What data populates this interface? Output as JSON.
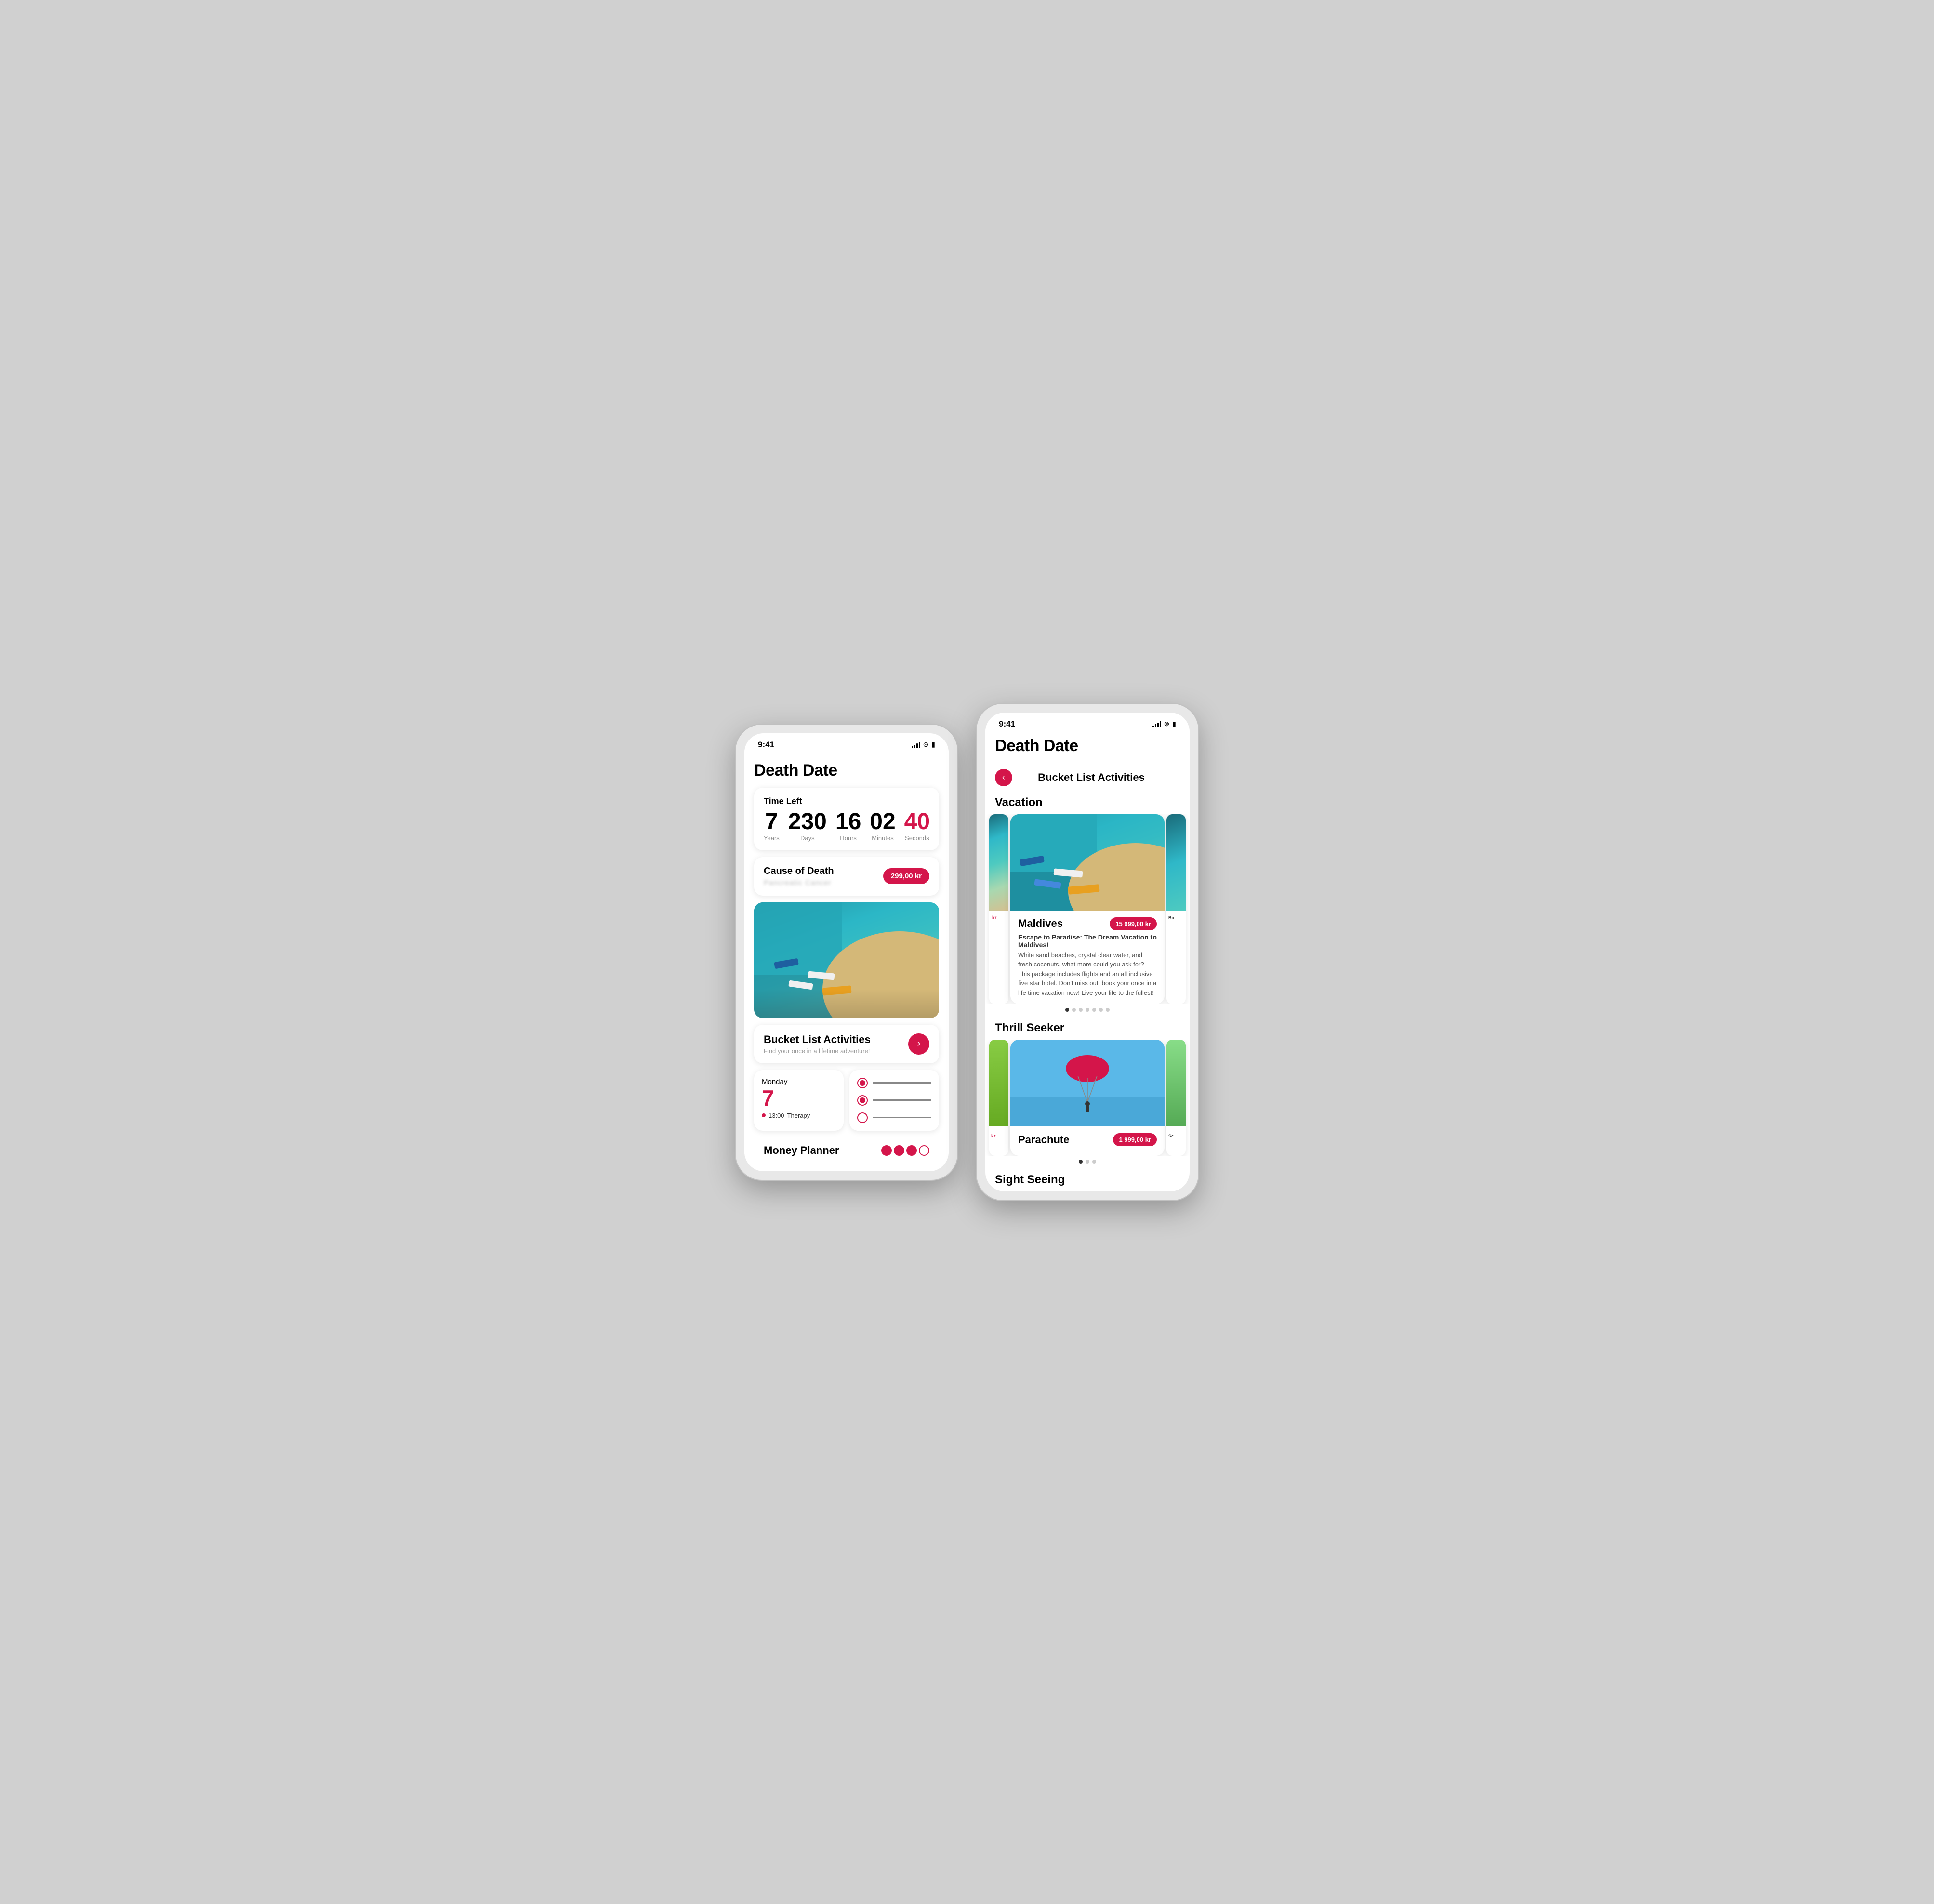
{
  "app": {
    "title": "Death Date",
    "status_time": "9:41"
  },
  "left_phone": {
    "time_left": {
      "card_title": "Time Left",
      "years_value": "7",
      "years_label": "Years",
      "days_value": "230",
      "days_label": "Days",
      "hours_value": "16",
      "hours_label": "Hours",
      "minutes_value": "02",
      "minutes_label": "Minutes",
      "seconds_value": "40",
      "seconds_label": "Seconds"
    },
    "cause_of_death": {
      "title": "Cause of Death",
      "value": "Pancreatic Cancer",
      "price": "299,00 kr"
    },
    "bucket_list": {
      "title": "Bucket List Activities",
      "subtitle": "Find your once in a lifetime adventure!"
    },
    "calendar": {
      "day_name": "Monday",
      "day_number": "7",
      "event_time": "13:00",
      "event_name": "Therapy"
    },
    "money_planner": {
      "title": "Money Planner"
    }
  },
  "right_phone": {
    "header_title": "Bucket List Activities",
    "back_label": "‹",
    "vacation_section": "Vacation",
    "activity_maldives": {
      "name": "Maldives",
      "price": "15 999,00 kr",
      "desc_title": "Escape to Paradise: The Dream Vacation to Maldives!",
      "description": "White sand beaches, crystal clear water, and fresh coconuts, what more could you ask for? This package includes flights and an all inclusive five star hotel. Don't miss out, book your once in a life time vacation now! Live your life to the fullest!"
    },
    "thrill_section": "Thrill Seeker",
    "activity_parachute": {
      "name": "Parachute",
      "price": "1 999,00 kr"
    },
    "sight_section": "Sight Seeing"
  }
}
